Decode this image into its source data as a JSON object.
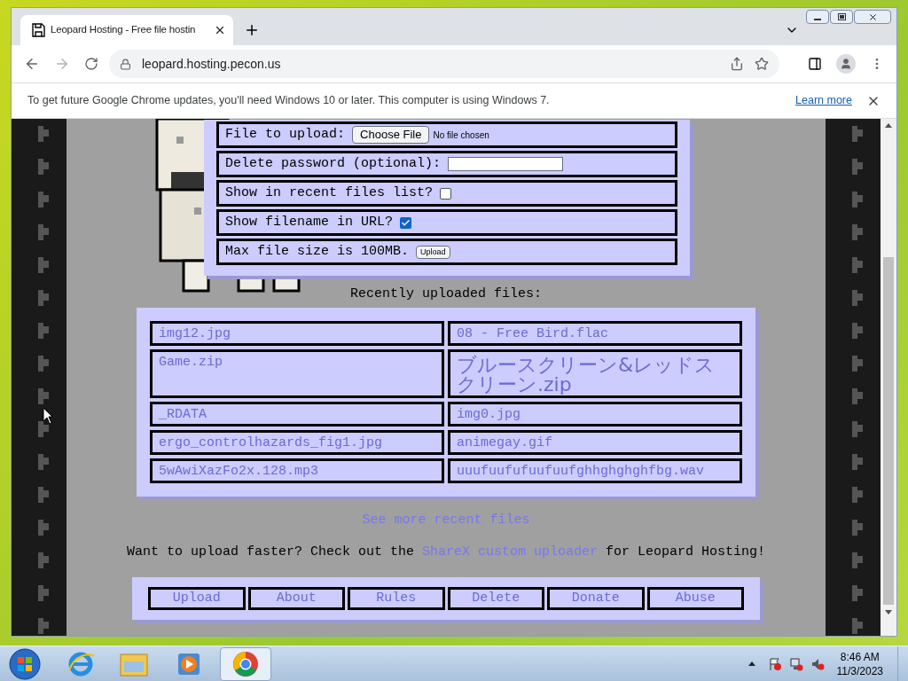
{
  "browser": {
    "tab_title": "Leopard Hosting - Free file hostin",
    "url": "leopard.hosting.pecon.us",
    "infobar": {
      "message": "To get future Google Chrome updates, you'll need Windows 10 or later. This computer is using Windows 7.",
      "link": "Learn more"
    }
  },
  "upload_form": {
    "rows": [
      {
        "kind": "file",
        "label": "File to upload:",
        "button": "Choose File",
        "status": "No file chosen"
      },
      {
        "kind": "password",
        "label": "Delete password (optional):"
      },
      {
        "kind": "checkbox",
        "label": "Show in recent files list?",
        "checked": false
      },
      {
        "kind": "checkbox",
        "label": "Show filename in URL?",
        "checked": true
      },
      {
        "kind": "submit",
        "label": "Max file size is 100MB.",
        "button": "Upload"
      }
    ]
  },
  "recent_files": {
    "heading": "Recently uploaded files:",
    "files": [
      "img12.jpg",
      "08 - Free Bird.flac",
      "Game.zip",
      "ブルースクリーン&レッドスクリーン.zip",
      "_RDATA",
      "img0.jpg",
      "ergo_controlhazards_fig1.jpg",
      "animegay.gif",
      "5wAwiXazFo2x.128.mp3",
      "uuufuufufuufuufghhghghghfbg.wav"
    ],
    "more_link": "See more recent files"
  },
  "sharex_note": {
    "before": "Want to upload faster? Check out the ",
    "link": "ShareX custom uploader",
    "after": " for Leopard Hosting!"
  },
  "nav": [
    "Upload",
    "About",
    "Rules",
    "Delete",
    "Donate",
    "Abuse"
  ],
  "taskbar": {
    "time": "8:46 AM",
    "date": "11/3/2023"
  }
}
